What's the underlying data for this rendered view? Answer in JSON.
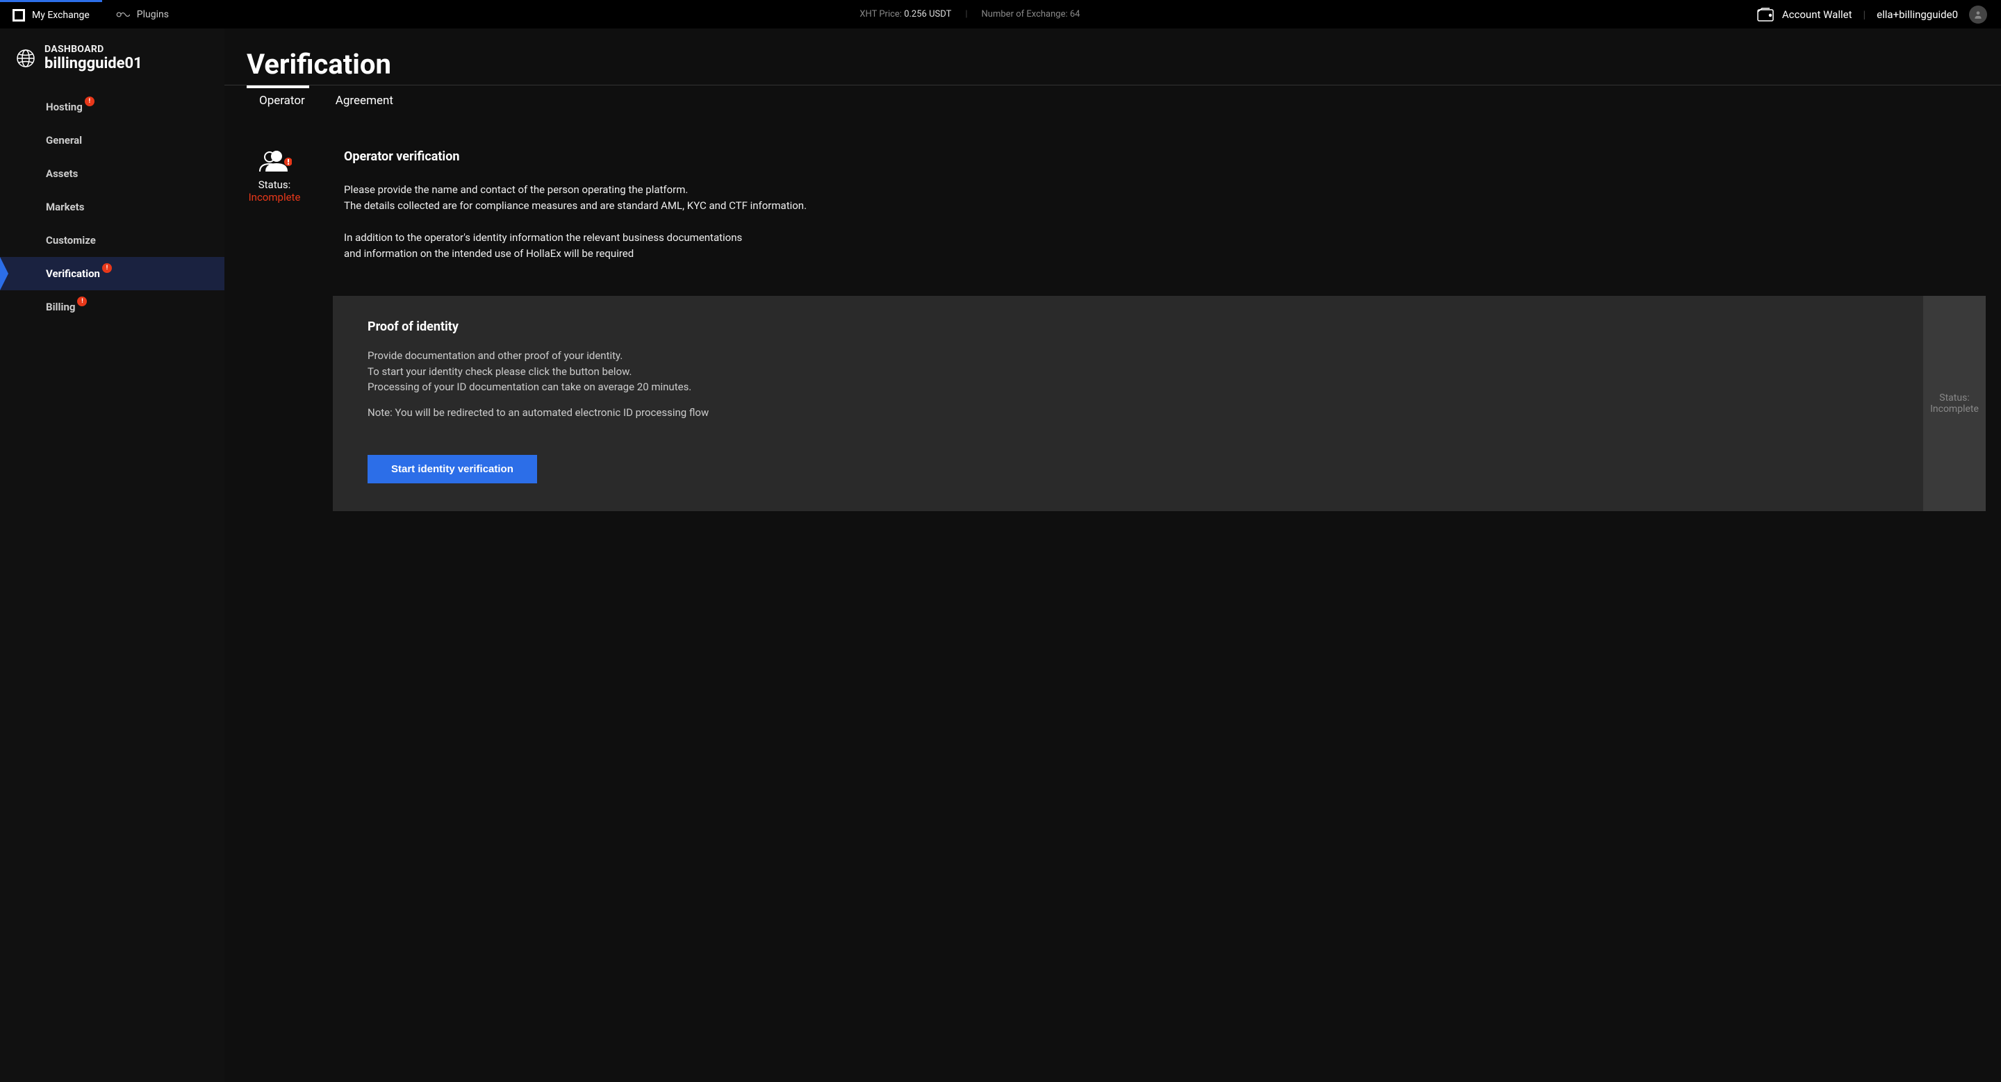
{
  "topbar": {
    "app_name": "My Exchange",
    "plugins": "Plugins",
    "price_label": "XHT Price: ",
    "price_value": "0.256 USDT",
    "exchange_count": "Number of Exchange: 64",
    "wallet": "Account Wallet",
    "username": "ella+billingguide0"
  },
  "sidebar": {
    "dashboard_label": "DASHBOARD",
    "dashboard_name": "billingguide01",
    "items": [
      {
        "label": "Hosting",
        "badge": "!"
      },
      {
        "label": "General",
        "badge": null
      },
      {
        "label": "Assets",
        "badge": null
      },
      {
        "label": "Markets",
        "badge": null
      },
      {
        "label": "Customize",
        "badge": null
      },
      {
        "label": "Verification",
        "badge": "!",
        "active": true
      },
      {
        "label": "Billing",
        "badge": "!"
      }
    ]
  },
  "page": {
    "title": "Verification",
    "tabs": [
      {
        "label": "Operator",
        "active": true
      },
      {
        "label": "Agreement",
        "active": false
      }
    ],
    "status": {
      "label": "Status:",
      "value": "Incomplete"
    },
    "operator": {
      "heading": "Operator verification",
      "p1a": "Please provide the name and contact of the person operating the platform.",
      "p1b": "The details collected are for compliance measures and are standard AML, KYC and CTF information.",
      "p2a": "In addition to the operator's identity information the relevant business documentations",
      "p2b": "and information on the intended use of HollaEx will be required"
    },
    "proof": {
      "heading": "Proof of identity",
      "p1a": "Provide documentation and other proof of your identity.",
      "p1b": "To start your identity check please click the button below.",
      "p1c": "Processing of your ID documentation can take on average 20 minutes.",
      "p2": "Note: You will be redirected to an automated electronic ID processing flow",
      "button": "Start identity verification",
      "side_status_label": "Status:",
      "side_status_value": "Incomplete"
    }
  }
}
